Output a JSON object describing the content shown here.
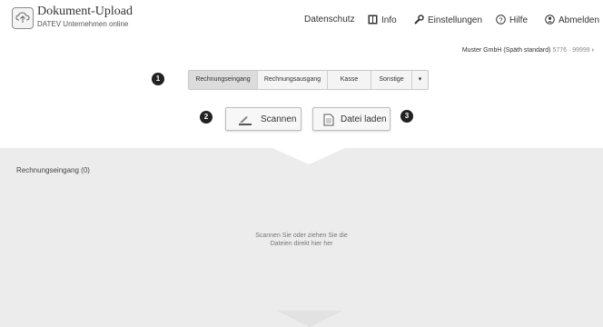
{
  "header": {
    "app_title": "Dokument-Upload",
    "app_subtitle": "DATEV Unternehmen online",
    "nav": {
      "datenschutz": "Datenschutz",
      "info": "Info",
      "einstellungen": "Einstellungen",
      "hilfe": "Hilfe",
      "abmelden": "Abmelden"
    }
  },
  "account": {
    "name": "Muster GmbH (Späth standard)",
    "number": "5776 · 99999",
    "chevron": "›"
  },
  "badges": {
    "one": "1",
    "two": "2",
    "three": "3"
  },
  "categories": {
    "items": [
      "Rechnungseingang",
      "Rechnungsausgang",
      "Kasse",
      "Sonstige"
    ],
    "more": "▾",
    "selected": "Rechnungseingang"
  },
  "actions": {
    "scan_label": "Scannen",
    "file_label": "Datei laden"
  },
  "dropzone": {
    "title": "Rechnungseingang (0)",
    "hint_line1": "Scannen Sie oder ziehen Sie die",
    "hint_line2": "Dateien direkt hier her"
  },
  "colors": {
    "dropzone_bg": "#ececec",
    "active_segment": "#dcdcdc",
    "badge": "#222222"
  },
  "icons": [
    "cloud-upload-icon",
    "info-book-icon",
    "wrench-icon",
    "help-icon",
    "logout-user-icon",
    "scanner-icon",
    "document-icon"
  ]
}
